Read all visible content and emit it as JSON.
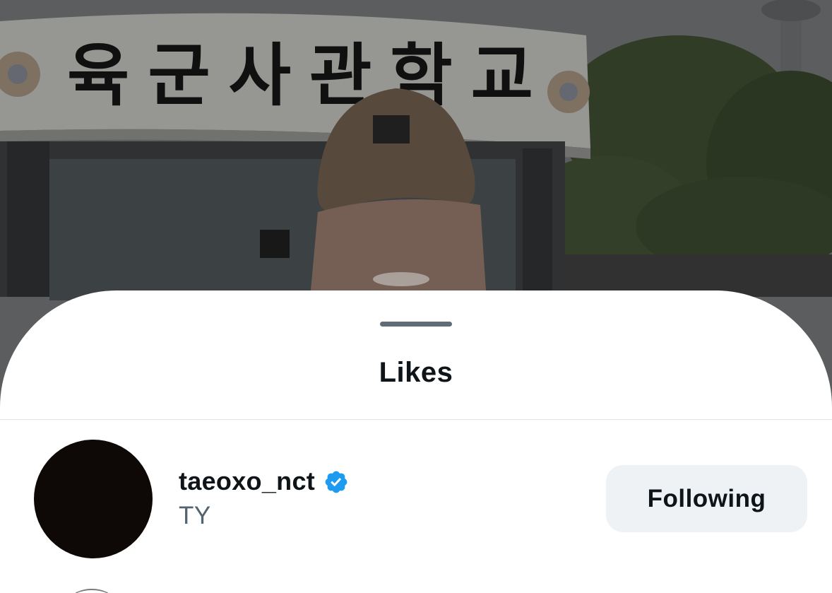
{
  "background": {
    "sign_text": "육군사관학교",
    "description_icon": "photo-background"
  },
  "sheet": {
    "title": "Likes"
  },
  "users": [
    {
      "display_name": "taeoxo_nct",
      "handle": "TY",
      "verified": true,
      "follow_label": "Following"
    }
  ],
  "colors": {
    "accent_verified": "#1d9bf0",
    "button_bg": "#eff2f5",
    "text_primary": "#0f1419",
    "text_secondary": "#536471"
  }
}
